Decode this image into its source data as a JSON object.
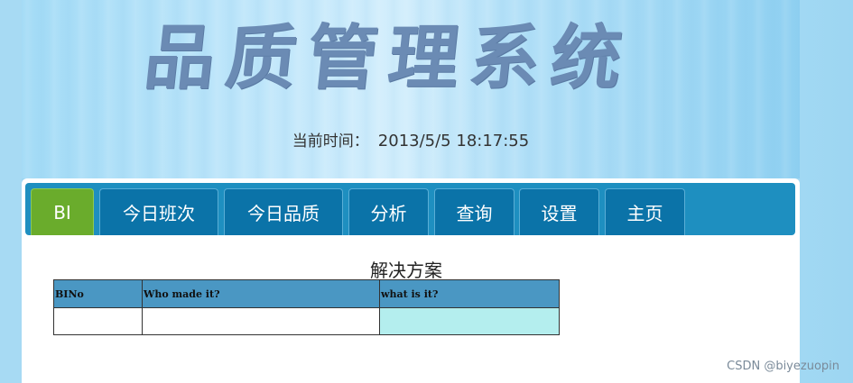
{
  "header": {
    "title": "品质管理系统",
    "clock_label": "当前时间：",
    "clock_value": "2013/5/5 18:17:55"
  },
  "nav": {
    "tabs": [
      {
        "label": "BI",
        "active": true
      },
      {
        "label": "今日班次",
        "active": false
      },
      {
        "label": "今日品质",
        "active": false
      },
      {
        "label": "分析",
        "active": false
      },
      {
        "label": "查询",
        "active": false
      },
      {
        "label": "设置",
        "active": false
      },
      {
        "label": "主页",
        "active": false
      }
    ]
  },
  "solution": {
    "title": "解决方案",
    "columns": [
      "BINo",
      "Who made it?",
      "what is it?"
    ],
    "rows": [
      [
        "",
        "",
        ""
      ]
    ]
  },
  "watermark": "CSDN @biyezuopin",
  "colors": {
    "nav_bar": "#1e8fc0",
    "tab": "#0b73a8",
    "tab_active": "#6aac2c",
    "table_header": "#4a97c3",
    "highlight_cell": "#b4eeee",
    "title": "#6b8bb4"
  }
}
